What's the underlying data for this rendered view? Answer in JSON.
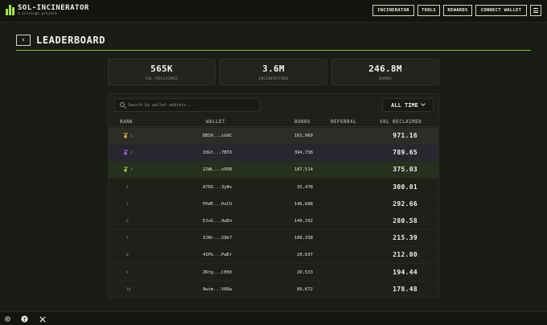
{
  "brand": {
    "title": "SOL-INCINERATOR",
    "subtitle": "a solslugs project",
    "accent": "#a6e34a"
  },
  "nav": {
    "incinerator": "INCINERATOR",
    "tools": "TOOLS",
    "rewards": "REWARDS",
    "connect_wallet": "CONNECT WALLET"
  },
  "page": {
    "title": "LEADERBOARD"
  },
  "stats": [
    {
      "value": "565K",
      "label": "SOL RECLAIMED"
    },
    {
      "value": "3.6M",
      "label": "INCINERATORS"
    },
    {
      "value": "246.8M",
      "label": "BURNS"
    }
  ],
  "search": {
    "placeholder": "Search by wallet address...",
    "value": ""
  },
  "range": {
    "selected": "ALL TIME"
  },
  "table": {
    "headers": {
      "rank": "RANK",
      "wallet": "WALLET",
      "burns": "BURNS",
      "referral": "REFERRAL",
      "sol": "SOL RECLAIMED"
    },
    "rows": [
      {
        "rank": "1",
        "wallet": "DBSX...iGUC",
        "burns": "101,969",
        "referral": "-",
        "sol": "971.16",
        "medal": "gold"
      },
      {
        "rank": "2",
        "wallet": "33Gt...7BTX",
        "burns": "394,738",
        "referral": "-",
        "sol": "789.65",
        "medal": "purple"
      },
      {
        "rank": "3",
        "wallet": "22WL...x95R",
        "burns": "187,514",
        "referral": "-",
        "sol": "375.03",
        "medal": "green"
      },
      {
        "rank": "4",
        "wallet": "A7DX...3yWv",
        "burns": "35,478",
        "referral": "-",
        "sol": "300.01"
      },
      {
        "rank": "5",
        "wallet": "FHdE...HxCU",
        "burns": "146,688",
        "referral": "-",
        "sol": "292.66"
      },
      {
        "rank": "6",
        "wallet": "EJvG...9wEn",
        "burns": "140,292",
        "referral": "-",
        "sol": "280.58"
      },
      {
        "rank": "7",
        "wallet": "3JNr...SQk7",
        "burns": "108,338",
        "referral": "-",
        "sol": "215.39"
      },
      {
        "rank": "8",
        "wallet": "43Pk...PwEr",
        "burns": "20,637",
        "referral": "-",
        "sol": "212.00"
      },
      {
        "rank": "9",
        "wallet": "ZKtg...CEHX",
        "burns": "20,533",
        "referral": "-",
        "sol": "194.44"
      },
      {
        "rank": "10",
        "wallet": "9wim...V8Qw",
        "burns": "89,672",
        "referral": "-",
        "sol": "178.48"
      }
    ]
  },
  "footer": {
    "icons": [
      "gear-icon",
      "help-icon",
      "x-logo-icon"
    ]
  }
}
